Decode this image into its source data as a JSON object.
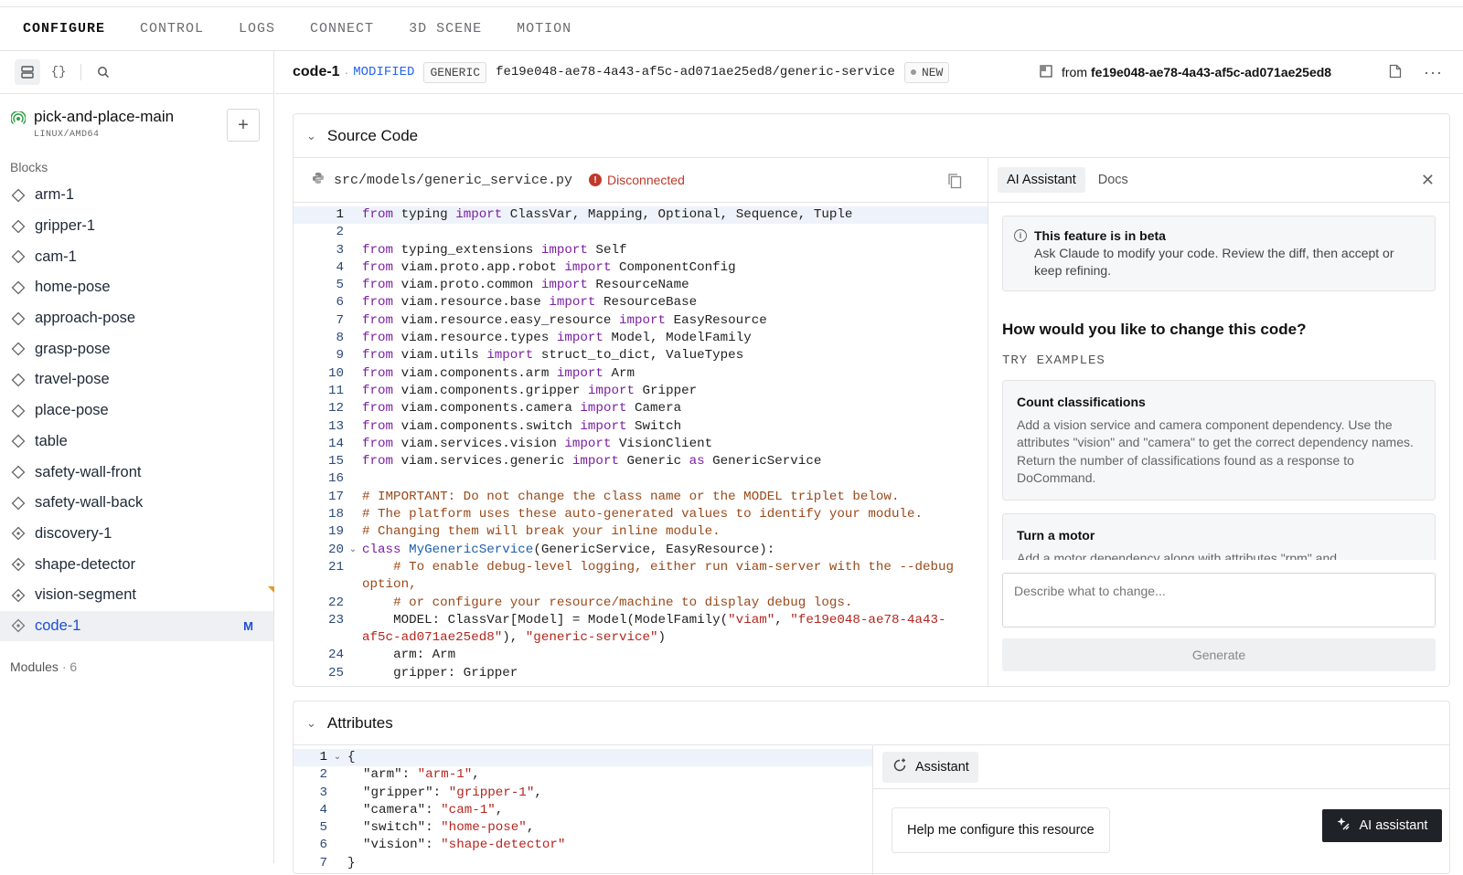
{
  "nav": {
    "tabs": [
      "CONFIGURE",
      "CONTROL",
      "LOGS",
      "CONNECT",
      "3D SCENE",
      "MOTION"
    ]
  },
  "sidebar": {
    "machine_name": "pick-and-place-main",
    "machine_arch": "LINUX/AMD64",
    "add_label": "+",
    "blocks_heading": "Blocks",
    "items": [
      {
        "label": "arm-1",
        "icon": "diamond-icon"
      },
      {
        "label": "gripper-1",
        "icon": "diamond-icon"
      },
      {
        "label": "cam-1",
        "icon": "diamond-icon"
      },
      {
        "label": "home-pose",
        "icon": "diamond-icon"
      },
      {
        "label": "approach-pose",
        "icon": "diamond-icon"
      },
      {
        "label": "grasp-pose",
        "icon": "diamond-icon"
      },
      {
        "label": "travel-pose",
        "icon": "diamond-icon"
      },
      {
        "label": "place-pose",
        "icon": "diamond-icon"
      },
      {
        "label": "table",
        "icon": "diamond-icon"
      },
      {
        "label": "safety-wall-front",
        "icon": "diamond-icon"
      },
      {
        "label": "safety-wall-back",
        "icon": "diamond-icon"
      },
      {
        "label": "discovery-1",
        "icon": "service-diamond-icon"
      },
      {
        "label": "shape-detector",
        "icon": "service-diamond-icon"
      },
      {
        "label": "vision-segment",
        "icon": "service-diamond-icon"
      },
      {
        "label": "code-1",
        "icon": "service-diamond-icon",
        "badge": "M",
        "selected": true
      }
    ],
    "modules_label": "Modules",
    "modules_count": "· 6"
  },
  "header": {
    "title": "code-1",
    "sep": "·",
    "modified": "MODIFIED",
    "kind": "GENERIC",
    "path": "fe19e048-ae78-4a43-af5c-ad071ae25ed8/generic-service",
    "new_label": "NEW",
    "from_label": "from",
    "from_value": "fe19e048-ae78-4a43-af5c-ad071ae25ed8",
    "more": "···"
  },
  "source": {
    "title": "Source Code",
    "file": "src/models/generic_service.py",
    "status": "Disconnected"
  },
  "ai": {
    "tab_ai": "AI Assistant",
    "tab_docs": "Docs",
    "close": "✕",
    "beta_title": "This feature is in beta",
    "beta_body": "Ask Claude to modify your code. Review the diff, then accept or keep refining.",
    "question": "How would you like to change this code?",
    "try_label": "TRY EXAMPLES",
    "examples": [
      {
        "title": "Count classifications",
        "desc": "Add a vision service and camera component dependency. Use the attributes \"vision\" and \"camera\" to get the correct dependency names. Return the number of classifications found as a response to DoCommand."
      },
      {
        "title": "Turn a motor",
        "desc": "Add a motor dependency along with attributes \"rpm\" and"
      }
    ],
    "input_placeholder": "Describe what to change...",
    "generate": "Generate"
  },
  "attributes": {
    "title": "Attributes",
    "assistant_tab": "Assistant",
    "help_button": "Help me configure this resource"
  },
  "fab": {
    "label": "AI assistant"
  },
  "colors": {
    "accent": "#2563eb",
    "error": "#c0392b",
    "keyword": "#7c1fa2",
    "string": "#b3261e",
    "comment": "#9a4a1a"
  }
}
